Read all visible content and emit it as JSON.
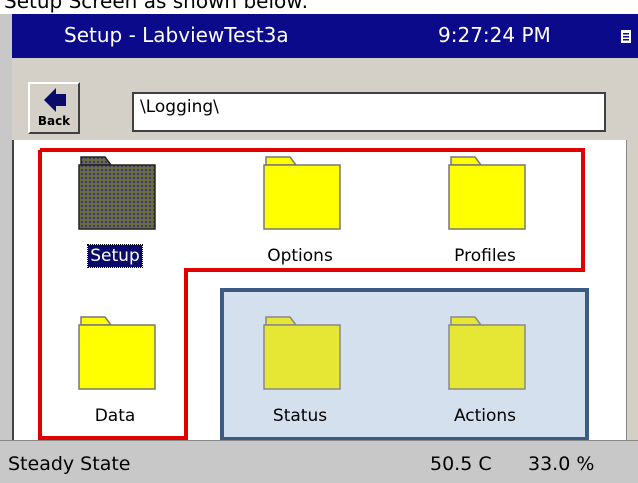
{
  "caption": "Setup Screen as shown below:",
  "window": {
    "title": "Setup - LabviewTest3a",
    "time": "9:27:24 PM"
  },
  "toolbar": {
    "back_label": "Back",
    "path_value": "\\Logging\\"
  },
  "folders": [
    {
      "label": "Setup",
      "selected": true
    },
    {
      "label": "Options",
      "selected": false
    },
    {
      "label": "Profiles",
      "selected": false
    },
    {
      "label": "Data",
      "selected": false
    },
    {
      "label": "Status",
      "selected": false
    },
    {
      "label": "Actions",
      "selected": false
    }
  ],
  "status": {
    "state": "Steady State",
    "temperature": "50.5 C",
    "percent": "33.0 %"
  },
  "colors": {
    "titlebar": "#0a0a8a",
    "folder_fill": "#ffff00",
    "highlight_fill": "#d5e0ee",
    "highlight_border": "#3b5b85",
    "annotation_red": "#e00000"
  }
}
